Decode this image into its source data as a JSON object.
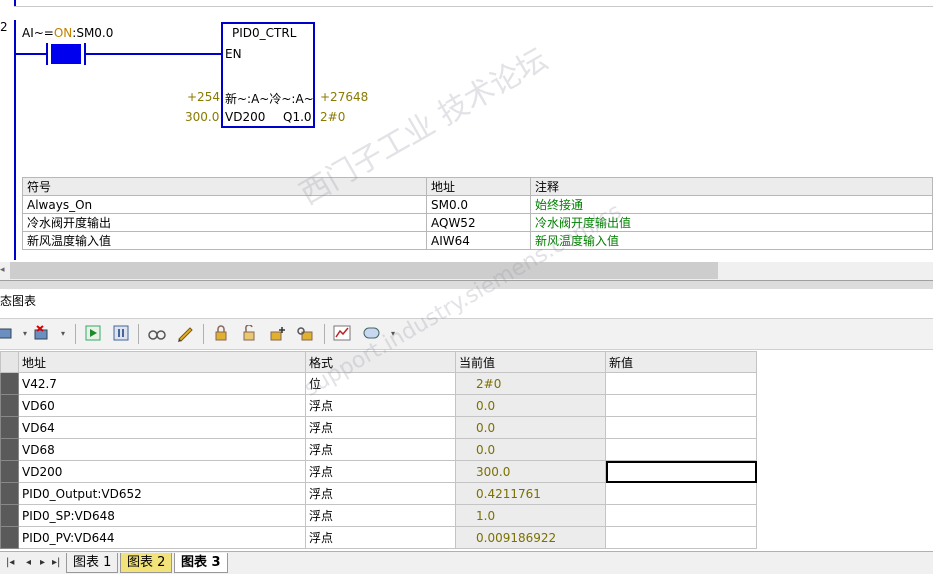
{
  "ladder": {
    "network_number": "2",
    "contact_label_prefix": "AI~=",
    "contact_label_on": "ON",
    "contact_label_suffix": ":SM0.0",
    "pid_block": {
      "title": "PID0_CTRL",
      "en_pin": "EN",
      "in_pin": "新~:A~冷~:A~",
      "in_param": "+254",
      "out_param": "+27648",
      "setpoint_pin": "VD200",
      "setpoint_param": "300.0",
      "q_pin": "Q1.0",
      "q_param": "2#0"
    },
    "symbol_table": {
      "headers": [
        "符号",
        "地址",
        "注释"
      ],
      "rows": [
        [
          "Always_On",
          "SM0.0",
          "始终接通"
        ],
        [
          "冷水阀开度输出",
          "AQW52",
          "冷水阀开度输出值"
        ],
        [
          "新风温度输入值",
          "AIW64",
          "新风温度输入值"
        ]
      ]
    }
  },
  "panel": {
    "title": "状态图表"
  },
  "status_chart": {
    "headers": [
      "地址",
      "格式",
      "当前值",
      "新值"
    ],
    "rows": [
      {
        "address": "V42.7",
        "format": "位",
        "current": "2#0",
        "new": ""
      },
      {
        "address": "VD60",
        "format": "浮点",
        "current": "0.0",
        "new": ""
      },
      {
        "address": "VD64",
        "format": "浮点",
        "current": "0.0",
        "new": ""
      },
      {
        "address": "VD68",
        "format": "浮点",
        "current": "0.0",
        "new": ""
      },
      {
        "address": "VD200",
        "format": "浮点",
        "current": "300.0",
        "new": ""
      },
      {
        "address": "PID0_Output:VD652",
        "format": "浮点",
        "current": "0.4211761",
        "new": ""
      },
      {
        "address": "PID0_SP:VD648",
        "format": "浮点",
        "current": "1.0",
        "new": ""
      },
      {
        "address": "PID0_PV:VD644",
        "format": "浮点",
        "current": "0.009186922",
        "new": ""
      }
    ]
  },
  "tabs": [
    {
      "label": "图表 1",
      "state": "normal"
    },
    {
      "label": "图表 2",
      "state": "yellow"
    },
    {
      "label": "图表 3",
      "state": "active"
    }
  ],
  "watermark": {
    "line1": "西门子工业  技术论坛",
    "line2": "support.industry.siemens.com/cs"
  },
  "colors": {
    "rail": "#0000cc",
    "param": "#8a7a00",
    "comment_green": "#008000",
    "tab_yellow": "#f2e27a"
  }
}
